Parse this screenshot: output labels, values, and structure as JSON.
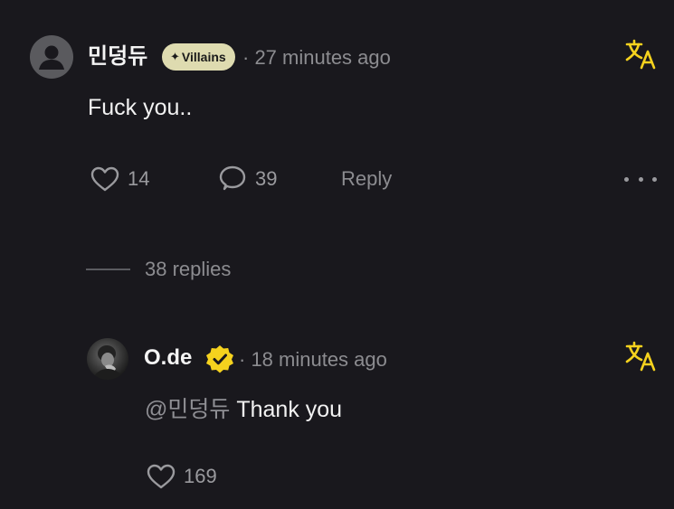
{
  "comment": {
    "username": "민덩듀",
    "badge_label": "Villains",
    "time": "· 27 minutes ago",
    "text": "Fuck you..",
    "likes": "14",
    "reply_count": "39",
    "reply_label": "Reply",
    "replies_toggle": "38 replies"
  },
  "reply": {
    "username": "O.de",
    "time": "· 18 minutes ago",
    "mention": "@민덩듀",
    "text": "Thank you",
    "likes": "169"
  },
  "icons": {
    "translate": "translate-icon",
    "heart": "heart-icon",
    "comment": "comment-bubble-icon",
    "more": "more-horizontal-icon",
    "verified": "verified-badge-icon"
  },
  "colors": {
    "background": "#19181d",
    "badge_bg": "#dedbb0",
    "accent_yellow": "#f5d21e",
    "muted_text": "#8c8c90"
  }
}
